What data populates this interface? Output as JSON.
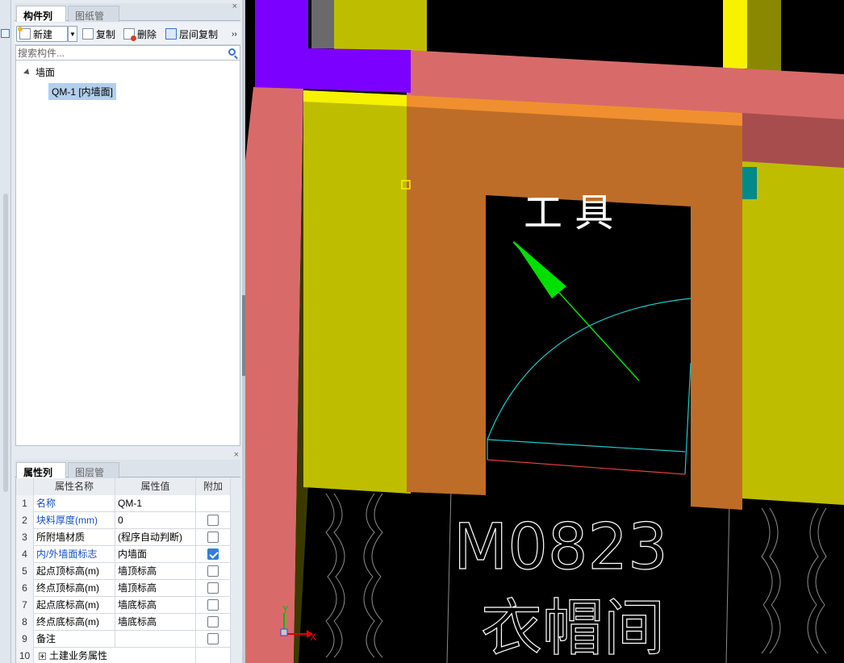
{
  "component_panel": {
    "tabs": [
      {
        "label": "构件列表",
        "active": true
      },
      {
        "label": "图纸管理",
        "active": false
      }
    ],
    "close_label": "×",
    "toolbar": {
      "new_label": "新建",
      "copy_label": "复制",
      "delete_label": "删除",
      "layer_copy_label": "层间复制",
      "more_label": "››"
    },
    "search": {
      "placeholder": "搜索构件..."
    },
    "tree": {
      "category": "墙面",
      "items": [
        {
          "label": "QM-1 [内墙面]",
          "selected": true
        }
      ]
    }
  },
  "property_panel": {
    "tabs": [
      {
        "label": "属性列表",
        "active": true
      },
      {
        "label": "图层管理",
        "active": false
      }
    ],
    "close_label": "×",
    "columns": [
      "属性名称",
      "属性值",
      "附加"
    ],
    "rows": [
      {
        "num": "1",
        "name": "名称",
        "value": "QM-1",
        "blue": true,
        "checkbox": "none"
      },
      {
        "num": "2",
        "name": "块料厚度(mm)",
        "value": "0",
        "blue": true,
        "checkbox": "off"
      },
      {
        "num": "3",
        "name": "所附墙材质",
        "value": "(程序自动判断)",
        "blue": false,
        "checkbox": "off"
      },
      {
        "num": "4",
        "name": "内/外墙面标志",
        "value": "内墙面",
        "blue": true,
        "checkbox": "on"
      },
      {
        "num": "5",
        "name": "起点顶标高(m)",
        "value": "墙顶标高",
        "blue": false,
        "checkbox": "off"
      },
      {
        "num": "6",
        "name": "终点顶标高(m)",
        "value": "墙顶标高",
        "blue": false,
        "checkbox": "off"
      },
      {
        "num": "7",
        "name": "起点底标高(m)",
        "value": "墙底标高",
        "blue": false,
        "checkbox": "off"
      },
      {
        "num": "8",
        "name": "终点底标高(m)",
        "value": "墙底标高",
        "blue": false,
        "checkbox": "off"
      },
      {
        "num": "9",
        "name": "备注",
        "value": "",
        "blue": false,
        "checkbox": "off"
      },
      {
        "num": "10",
        "name": "土建业务属性",
        "value": "",
        "blue": false,
        "checkbox": "none",
        "expandable": true
      }
    ]
  },
  "viewport": {
    "drawing_text": {
      "door_code": "M0823",
      "room_name": "衣帽间",
      "top_text": "工 具"
    },
    "axis": {
      "x_label": "X",
      "y_label": "Y"
    },
    "colors": {
      "wall_yellow": "#bfbd00",
      "wall_brown": "#bd6d28",
      "wall_pink": "#d86b6a",
      "wall_purple": "#7b00ff",
      "arc_cyan": "#22c8c8",
      "arrow_green": "#00e000"
    }
  }
}
